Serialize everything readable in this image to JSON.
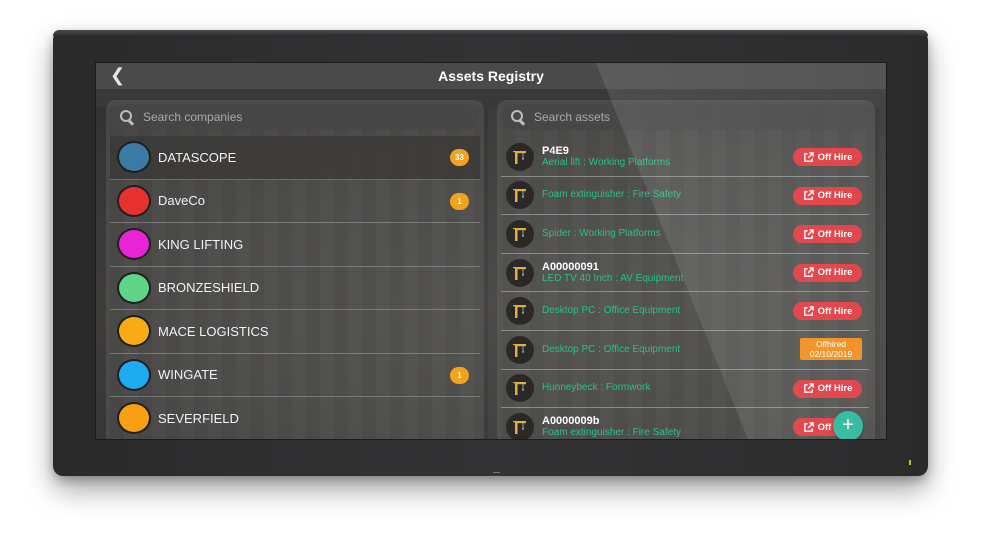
{
  "header": {
    "title": "Assets Registry",
    "back_icon": "chevron-left-icon"
  },
  "companies": {
    "search_placeholder": "Search companies",
    "items": [
      {
        "name": "DATASCOPE",
        "color": "#3b7aa5",
        "badge": "33",
        "selected": true
      },
      {
        "name": "DaveCo",
        "color": "#e6312f",
        "badge": "1"
      },
      {
        "name": "KING LIFTING",
        "color": "#e923d6",
        "badge": null
      },
      {
        "name": "BRONZESHIELD",
        "color": "#5fd58a",
        "badge": null
      },
      {
        "name": "MACE LOGISTICS",
        "color": "#f9ab16",
        "badge": null
      },
      {
        "name": "WINGATE",
        "color": "#1eabf2",
        "badge": "1"
      },
      {
        "name": "SEVERFIELD",
        "color": "#f99f12",
        "badge": null
      }
    ]
  },
  "assets": {
    "search_placeholder": "Search assets",
    "items": [
      {
        "id": "P4E9",
        "desc": "Aerial lift : Working Platforms",
        "status": "off_hire"
      },
      {
        "id": "",
        "desc": "Foam extinguisher : Fire Safety",
        "status": "off_hire"
      },
      {
        "id": "",
        "desc": "Spider : Working Platforms",
        "status": "off_hire"
      },
      {
        "id": "A00000091",
        "desc": "LED TV 40 Inch : AV Equipment",
        "status": "off_hire"
      },
      {
        "id": "",
        "desc": "Desktop PC : Office Equipment",
        "status": "off_hire"
      },
      {
        "id": "",
        "desc": "Desktop PC : Office Equipment",
        "status": "offhired",
        "offhired_label": "Offhired",
        "offhired_date": "02/10/2019"
      },
      {
        "id": "",
        "desc": "Hunneybeck : Formwork",
        "status": "off_hire"
      },
      {
        "id": "A0000009b",
        "desc": "Foam extinguisher : Fire Safety",
        "status": "off_hire"
      }
    ],
    "off_hire_label": "Off Hire",
    "add_label": "+"
  },
  "colors": {
    "accent_green": "#27c08a",
    "off_hire_red": "#e0393f",
    "offhired_orange": "#f08c1a",
    "badge_orange": "#f2a31e",
    "fab_teal": "#27b79a"
  }
}
